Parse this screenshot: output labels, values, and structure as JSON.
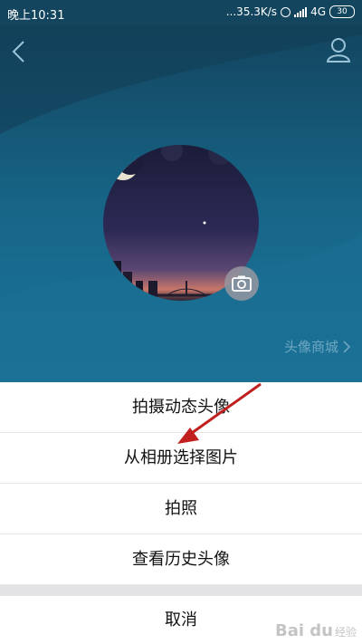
{
  "status_bar": {
    "time": "晚上10:31",
    "net_speed": "...35.3K/s",
    "network_type": "4G",
    "battery_level": "30"
  },
  "header": {
    "back_icon": "chevron-left-icon",
    "profile_icon": "user-icon"
  },
  "avatar": {
    "camera_icon": "camera-icon"
  },
  "avatar_mall": {
    "label": "头像商城",
    "chevron_icon": "chevron-right-icon"
  },
  "action_sheet": {
    "items": [
      {
        "label": "拍摄动态头像"
      },
      {
        "label": "从相册选择图片"
      },
      {
        "label": "拍照"
      },
      {
        "label": "查看历史头像"
      }
    ],
    "cancel_label": "取消"
  },
  "annotation": {
    "arrow_color": "#c0201e"
  },
  "watermark": {
    "brand": "Bai du",
    "sub": "经验"
  }
}
